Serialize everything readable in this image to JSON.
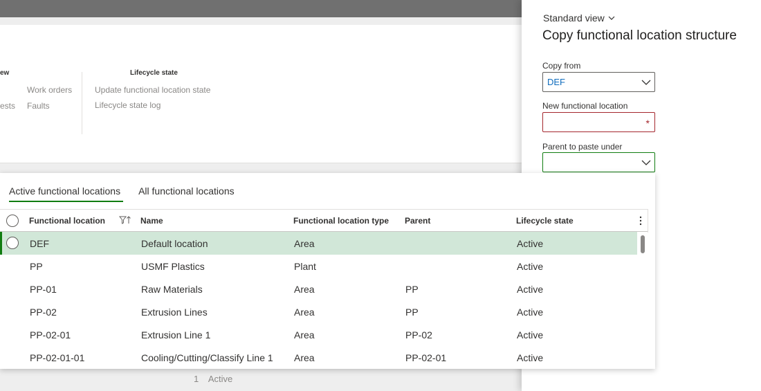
{
  "background": {
    "ribbon": {
      "group_view_title": "ew",
      "group_lifecycle_title": "Lifecycle state",
      "link_work_orders": "Work orders",
      "link_requests_partial": "ests",
      "link_faults": "Faults",
      "link_update_state": "Update functional location state",
      "link_state_log": "Lifecycle state log"
    },
    "footer": {
      "count": "1",
      "state": "Active"
    }
  },
  "panel": {
    "view_selector": "Standard view",
    "title": "Copy functional location structure",
    "copy_from": {
      "label": "Copy from",
      "value": "DEF"
    },
    "new_location": {
      "label": "New functional location",
      "value": ""
    },
    "parent": {
      "label": "Parent to paste under",
      "value": ""
    }
  },
  "lookup": {
    "tabs": [
      {
        "label": "Active functional locations",
        "active": true
      },
      {
        "label": "All functional locations",
        "active": false
      }
    ],
    "columns": {
      "location": "Functional location",
      "name": "Name",
      "type": "Functional location type",
      "parent": "Parent",
      "state": "Lifecycle state"
    },
    "rows": [
      {
        "location": "DEF",
        "name": "Default location",
        "type": "Area",
        "parent": "",
        "state": "Active"
      },
      {
        "location": "PP",
        "name": "USMF Plastics",
        "type": "Plant",
        "parent": "",
        "state": "Active"
      },
      {
        "location": "PP-01",
        "name": "Raw Materials",
        "type": "Area",
        "parent": "PP",
        "state": "Active"
      },
      {
        "location": "PP-02",
        "name": "Extrusion Lines",
        "type": "Area",
        "parent": "PP",
        "state": "Active"
      },
      {
        "location": "PP-02-01",
        "name": "Extrusion Line 1",
        "type": "Area",
        "parent": "PP-02",
        "state": "Active"
      },
      {
        "location": "PP-02-01-01",
        "name": "Cooling/Cutting/Classify Line 1",
        "type": "Area",
        "parent": "PP-02-01",
        "state": "Active"
      }
    ]
  },
  "colors": {
    "accent_green": "#107c10",
    "selected_row": "#d1e7d8",
    "link_blue": "#0f6cbd",
    "required_red": "#a4262c"
  },
  "icons": {
    "view_chevron": "chevron-down-icon",
    "dropdown_chevron": "chevron-down-icon",
    "filter": "filter-sort-icon",
    "more": "more-vertical-icon"
  }
}
